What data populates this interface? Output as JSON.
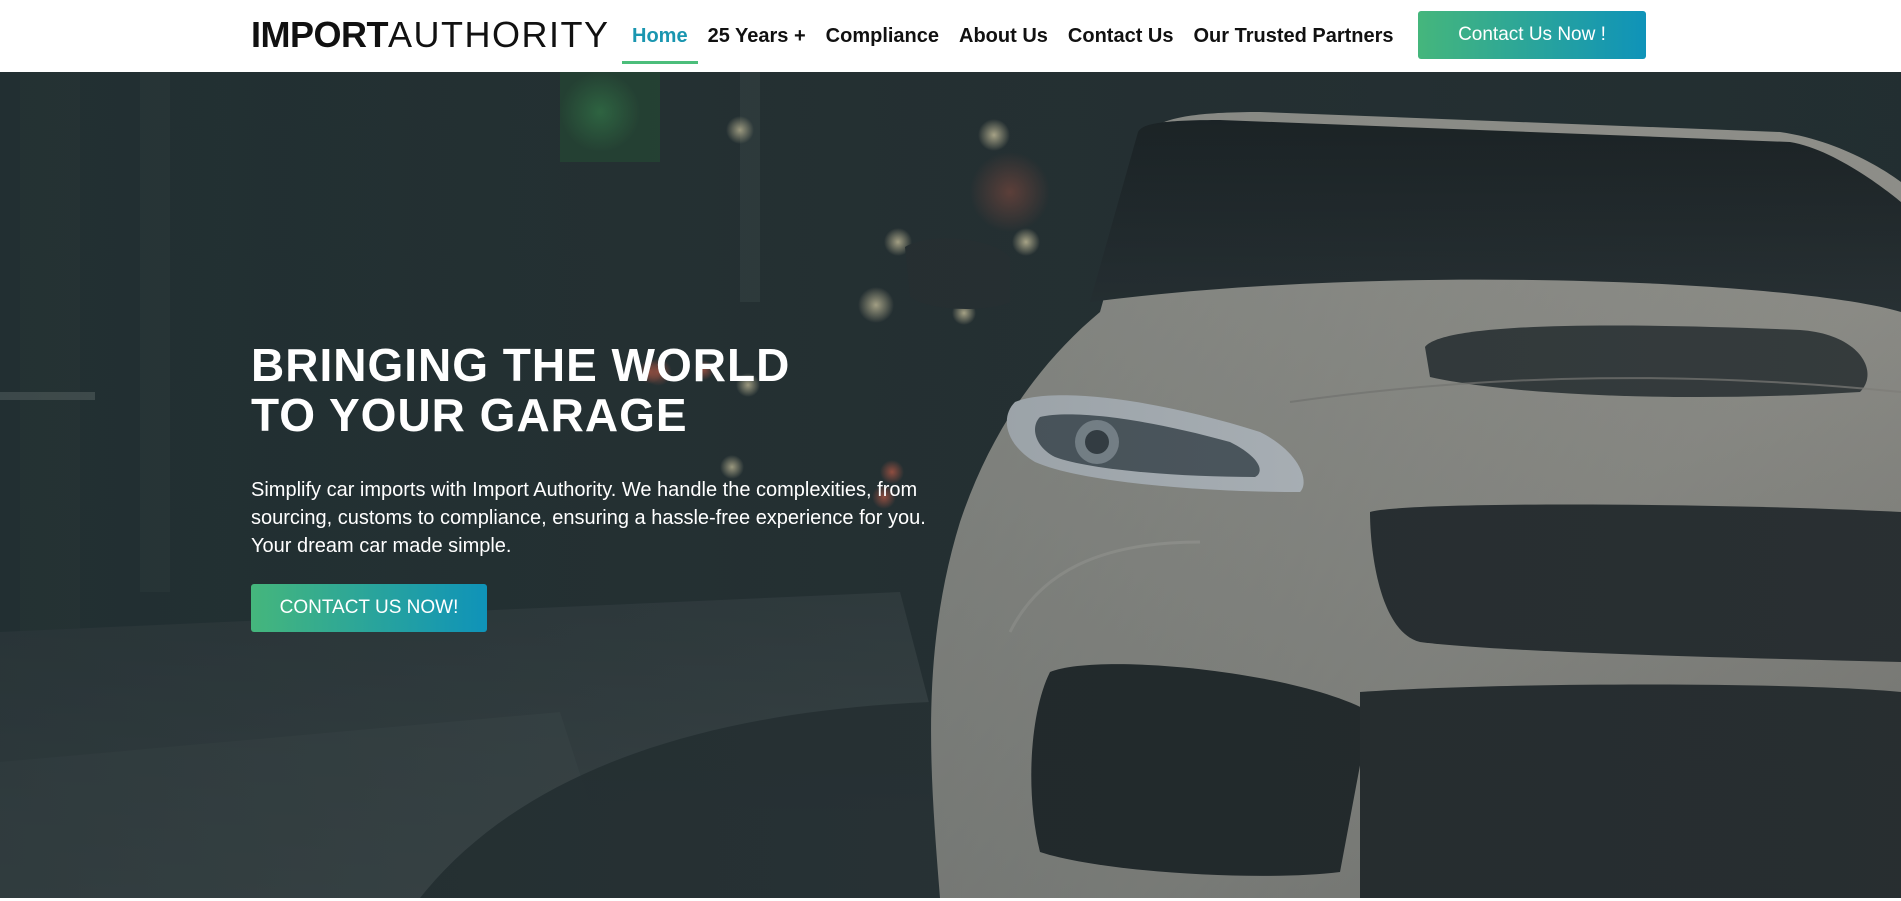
{
  "header": {
    "logo": {
      "bold": "IMPORT",
      "light": "AUTHORITY"
    },
    "nav": [
      {
        "label": "Home",
        "active": true
      },
      {
        "label": "25 Years +",
        "active": false
      },
      {
        "label": "Compliance",
        "active": false
      },
      {
        "label": "About Us",
        "active": false
      },
      {
        "label": "Contact Us",
        "active": false
      },
      {
        "label": "Our Trusted Partners",
        "active": false
      }
    ],
    "cta_label": "Contact Us Now !"
  },
  "hero": {
    "title_line1": "BRINGING THE WORLD",
    "title_line2": "TO YOUR GARAGE",
    "description": "Simplify car imports with Import Authority. We handle the complexities, from sourcing, customs to compliance, ensuring a hassle-free experience for you. Your dream car made simple.",
    "cta_label": "CONTACT US NOW!",
    "background_image": "white-sports-car-night-street"
  },
  "colors": {
    "accent_teal": "#1a96b0",
    "accent_green": "#4cbe7b",
    "gradient_start": "#45b67c",
    "gradient_end": "#0f93b9"
  }
}
